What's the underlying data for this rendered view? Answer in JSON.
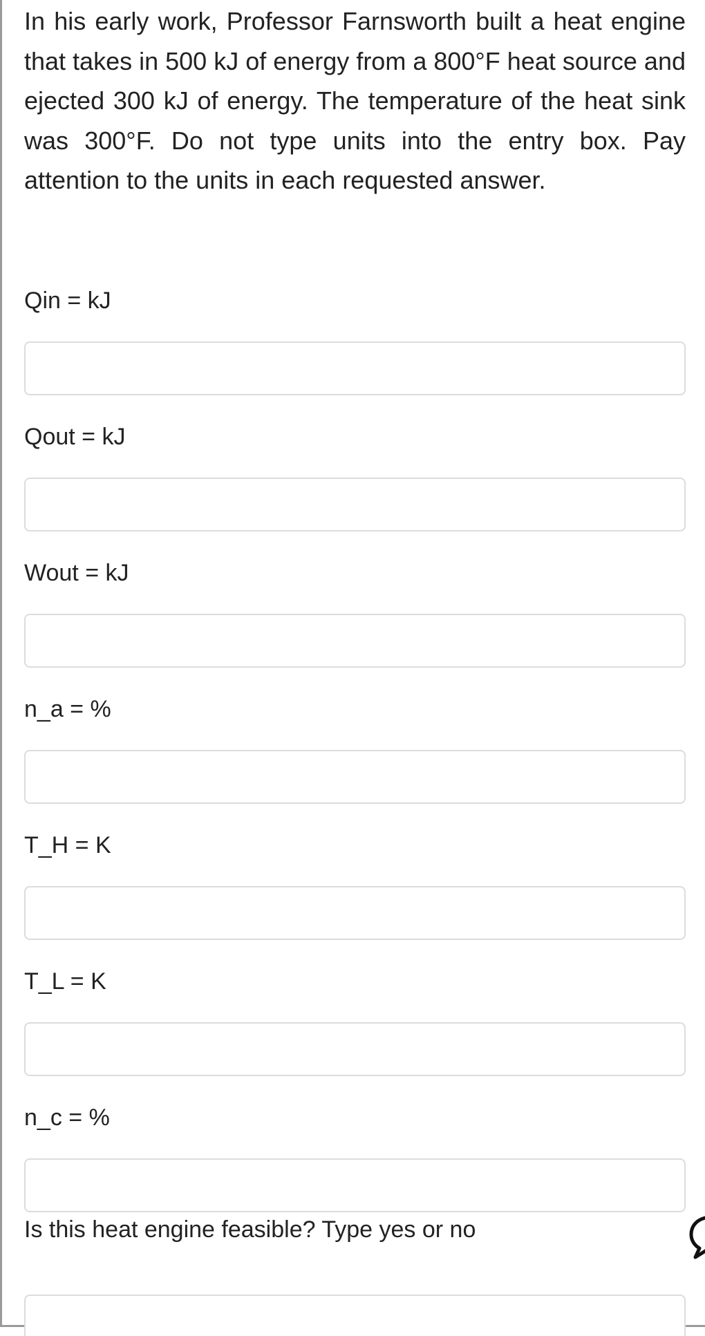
{
  "problem": {
    "text": "In his early work, Professor Farnsworth built a heat engine that takes in 500 kJ of energy from a 800°F heat source and ejected 300 kJ of energy. The temperature of the heat sink was 300°F. Do not type units into the entry box. Pay attention to the units in each requested answer."
  },
  "fields": [
    {
      "label": "Qin = kJ",
      "value": ""
    },
    {
      "label": "Qout = kJ",
      "value": ""
    },
    {
      "label": "Wout = kJ",
      "value": ""
    },
    {
      "label": "n_a = %",
      "value": ""
    },
    {
      "label": "T_H = K",
      "value": ""
    },
    {
      "label": "T_L = K",
      "value": ""
    },
    {
      "label": "n_c = %",
      "value": ""
    },
    {
      "label": "Is this heat engine feasible? Type yes or no",
      "value": ""
    }
  ],
  "icons": {
    "chat": "chat-bubble-icon"
  }
}
